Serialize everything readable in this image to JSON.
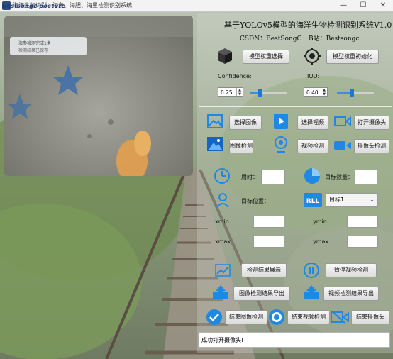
{
  "window": {
    "title": "海洋生物识别：海参、海胆、海星检测识别系统",
    "watermark": "Bestsongc posture",
    "minimize": "—",
    "maximize": "☐",
    "close": "✕"
  },
  "header": {
    "title": "基于YOLOv5模型的海洋生物检测识别系统V1.0",
    "csdn": "CSDN：BestSongC",
    "bilibili": "B站：Bestsongc"
  },
  "model": {
    "select_label": "模型权重选择",
    "init_label": "模型权重初始化",
    "confidence_label": "Confidence:",
    "confidence_value": "0.25",
    "confidence_fraction": 0.25,
    "iou_label": "IOU:",
    "iou_value": "0.40",
    "iou_fraction": 0.4
  },
  "source": {
    "select_image": "选择图像",
    "select_video": "选择视频",
    "open_camera": "打开摄像头",
    "image_detect": "图像检测",
    "video_detect": "视频检测",
    "camera_detect": "摄像头检测"
  },
  "result": {
    "time_label": "用时：",
    "time_value": "",
    "count_label": "目标数量：",
    "count_value": "",
    "position_label": "目标位置：",
    "target_selected": "目标1",
    "xmin_label": "xmin:",
    "ymin_label": "ymin:",
    "xmax_label": "xmax:",
    "ymax_label": "ymax:",
    "xmin": "",
    "ymin": "",
    "xmax": "",
    "ymax": ""
  },
  "actions": {
    "show_results": "检测结果展示",
    "pause_video": "暂停视频检测",
    "export_image": "图像检测结果导出",
    "export_video": "视频检测结果导出",
    "end_image": "结束图像检测",
    "end_video": "结束视频检测",
    "end_camera": "结束摄像头"
  },
  "status": "成功打开摄像头!",
  "toast": {
    "line1": "海参检测完成1条",
    "line2": "检测结果已保存"
  },
  "colors": {
    "accent_blue": "#1e88e5",
    "button_bg": "#e8e8e8",
    "status_bg": "#ffffff"
  }
}
